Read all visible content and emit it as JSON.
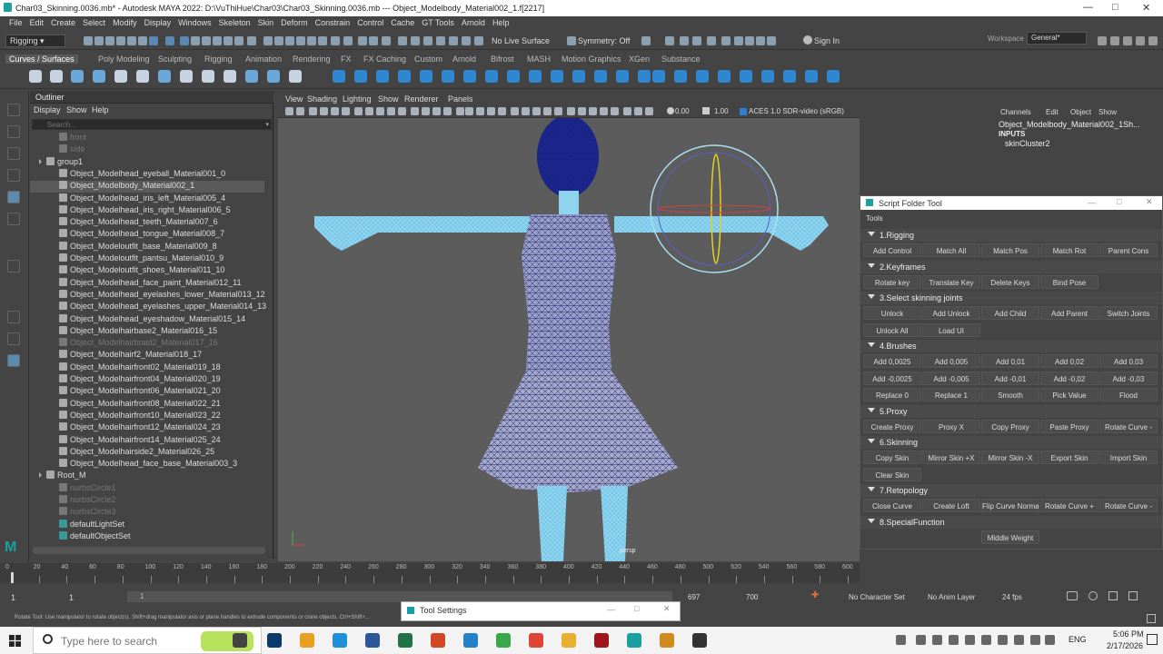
{
  "window": {
    "title": "Char03_Skinning.0036.mb* - Autodesk MAYA 2022: D:\\VuThiHue\\Char03\\Char03_Skinning.0036.mb   ---   Object_Modelbody_Material002_1.f[2217]"
  },
  "menubar": [
    "File",
    "Edit",
    "Create",
    "Select",
    "Modify",
    "Display",
    "Windows",
    "Skeleton",
    "Skin",
    "Deform",
    "Constrain",
    "Control",
    "Cache",
    "GT Tools",
    "Arnold",
    "Help"
  ],
  "statusline": {
    "menuset": "Rigging",
    "surface": "No Live Surface",
    "symmetry": "Symmetry: Off",
    "signin": "Sign In",
    "workspace_label": "Workspace :",
    "workspace": "General*"
  },
  "shelf_tabs": [
    "Curves / Surfaces",
    "Poly Modeling",
    "Sculpting",
    "Rigging",
    "Animation",
    "Rendering",
    "FX",
    "FX Caching",
    "Custom",
    "Arnold",
    "Bifrost",
    "MASH",
    "Motion Graphics",
    "XGen",
    "Substance"
  ],
  "outliner": {
    "title": "Outliner",
    "menu": [
      "Display",
      "Show",
      "Help"
    ],
    "search_placeholder": "Search...",
    "items": [
      {
        "label": "front",
        "dim": true,
        "indent": 1
      },
      {
        "label": "side",
        "dim": true,
        "indent": 1
      },
      {
        "label": "group1",
        "dim": false,
        "indent": 0
      },
      {
        "label": "Object_Modelhead_eyeball_Material001_0",
        "dim": false,
        "indent": 1
      },
      {
        "label": "Object_Modelbody_Material002_1",
        "dim": false,
        "indent": 1,
        "sel": true
      },
      {
        "label": "Object_Modelhead_iris_left_Material005_4",
        "dim": false,
        "indent": 1
      },
      {
        "label": "Object_Modelhead_iris_right_Material006_5",
        "dim": false,
        "indent": 1
      },
      {
        "label": "Object_Modelhead_teeth_Material007_6",
        "dim": false,
        "indent": 1
      },
      {
        "label": "Object_Modelhead_tongue_Material008_7",
        "dim": false,
        "indent": 1
      },
      {
        "label": "Object_Modeloutfit_base_Material009_8",
        "dim": false,
        "indent": 1
      },
      {
        "label": "Object_Modeloutfit_pantsu_Material010_9",
        "dim": false,
        "indent": 1
      },
      {
        "label": "Object_Modeloutfit_shoes_Material011_10",
        "dim": false,
        "indent": 1
      },
      {
        "label": "Object_Modelhead_face_paint_Material012_11",
        "dim": false,
        "indent": 1
      },
      {
        "label": "Object_Modelhead_eyelashes_lower_Material013_12",
        "dim": false,
        "indent": 1
      },
      {
        "label": "Object_Modelhead_eyelashes_upper_Material014_13",
        "dim": false,
        "indent": 1
      },
      {
        "label": "Object_Modelhead_eyeshadow_Material015_14",
        "dim": false,
        "indent": 1
      },
      {
        "label": "Object_Modelhairbase2_Material016_15",
        "dim": false,
        "indent": 1
      },
      {
        "label": "Object_Modelhairbraid2_Material017_16",
        "dim": true,
        "indent": 1
      },
      {
        "label": "Object_Modelhairf2_Material018_17",
        "dim": false,
        "indent": 1
      },
      {
        "label": "Object_Modelhairfront02_Material019_18",
        "dim": false,
        "indent": 1
      },
      {
        "label": "Object_Modelhairfront04_Material020_19",
        "dim": false,
        "indent": 1
      },
      {
        "label": "Object_Modelhairfront06_Material021_20",
        "dim": false,
        "indent": 1
      },
      {
        "label": "Object_Modelhairfront08_Material022_21",
        "dim": false,
        "indent": 1
      },
      {
        "label": "Object_Modelhairfront10_Material023_22",
        "dim": false,
        "indent": 1
      },
      {
        "label": "Object_Modelhairfront12_Material024_23",
        "dim": false,
        "indent": 1
      },
      {
        "label": "Object_Modelhairfront14_Material025_24",
        "dim": false,
        "indent": 1
      },
      {
        "label": "Object_Modelhairside2_Material026_25",
        "dim": false,
        "indent": 1
      },
      {
        "label": "Object_Modelhead_face_base_Material003_3",
        "dim": false,
        "indent": 1
      },
      {
        "label": "Root_M",
        "dim": false,
        "indent": 0
      },
      {
        "label": "nurbsCircle1",
        "dim": true,
        "indent": 1
      },
      {
        "label": "nurbsCircle2",
        "dim": true,
        "indent": 1
      },
      {
        "label": "nurbsCircle3",
        "dim": true,
        "indent": 1
      },
      {
        "label": "defaultLightSet",
        "dim": false,
        "indent": 1
      },
      {
        "label": "defaultObjectSet",
        "dim": false,
        "indent": 1
      }
    ]
  },
  "viewport": {
    "menu": [
      "View",
      "Shading",
      "Lighting",
      "Show",
      "Renderer",
      "Panels"
    ],
    "field1": "0.00",
    "field2": "1.00",
    "colorspace": "ACES 1.0 SDR-video (sRGB)",
    "camera": "persp"
  },
  "channelbox": {
    "menu": [
      "Channels",
      "Edit",
      "Object",
      "Show"
    ],
    "object": "Object_Modelbody_Material002_1Sh...",
    "inputs_label": "INPUTS",
    "input": "skinCluster2"
  },
  "script_tool": {
    "title": "Script Folder Tool",
    "menu": "Tools",
    "sections": [
      {
        "label": "1.Rigging",
        "rows": [
          [
            "Add Control",
            "Match All",
            "Match Pos",
            "Match Rot",
            "Parent Cons"
          ]
        ]
      },
      {
        "label": "2.Keyframes",
        "rows": [
          [
            "Rotate key",
            "Translate Key",
            "Delete Keys",
            "Bind Pose"
          ]
        ]
      },
      {
        "label": "3.Select skinning joints",
        "rows": [
          [
            "Unlock",
            "Add Unlock",
            "Add Child",
            "Add Parent",
            "Switch Joints"
          ],
          [
            "Unlock All",
            "Load UI"
          ]
        ]
      },
      {
        "label": "4.Brushes",
        "rows": [
          [
            "Add 0,0025",
            "Add 0,005",
            "Add 0,01",
            "Add 0,02",
            "Add 0,03"
          ],
          [
            "Add -0,0025",
            "Add -0,005",
            "Add -0,01",
            "Add -0,02",
            "Add -0,03"
          ],
          [
            "Replace 0",
            "Replace 1",
            "Smooth",
            "Pick Value",
            "Flood"
          ]
        ]
      },
      {
        "label": "5.Proxy",
        "rows": [
          [
            "Create Proxy",
            "Proxy X",
            "Copy Proxy",
            "Paste Proxy",
            "Rotate Curve -"
          ]
        ]
      },
      {
        "label": "6.Skinning",
        "rows": [
          [
            "Copy Skin",
            "Mirror Skin +X",
            "Mirror Skin -X",
            "Export Skin",
            "Import Skin"
          ],
          [
            "Clear Skin"
          ]
        ]
      },
      {
        "label": "7.Retopology",
        "rows": [
          [
            "Close Curve",
            "Create Loft",
            "Flip Curve Normal",
            "Rotate Curve +",
            "Rotate Curve -"
          ]
        ]
      },
      {
        "label": "8.SpecialFunction",
        "rows": [
          [
            "",
            "",
            "Middle Weight",
            "",
            ""
          ]
        ]
      }
    ]
  },
  "timeline": {
    "ticks": [
      "0",
      "20",
      "40",
      "60",
      "80",
      "100",
      "120",
      "140",
      "160",
      "180",
      "200",
      "220",
      "240",
      "260",
      "280",
      "300",
      "320",
      "340",
      "360",
      "380",
      "400",
      "420",
      "440",
      "460",
      "480",
      "500",
      "520",
      "540",
      "560",
      "580",
      "600"
    ]
  },
  "range": {
    "start": "1",
    "start2": "1",
    "handle": "1",
    "end_a": "697",
    "end_b": "700",
    "character": "No Character Set",
    "anim_layer": "No Anim Layer",
    "fps": "24 fps"
  },
  "help_line": "Rotate Tool: Use manipulator to rotate object(s). Shift+drag manipulator axis or plane handles to extrude components or clone objects. Ctrl+Shift+...",
  "tool_settings": {
    "title": "Tool Settings"
  },
  "taskbar": {
    "search_placeholder": "Type here to search",
    "lang": "ENG",
    "time": "5:06 PM",
    "date": "2/17/2026"
  }
}
